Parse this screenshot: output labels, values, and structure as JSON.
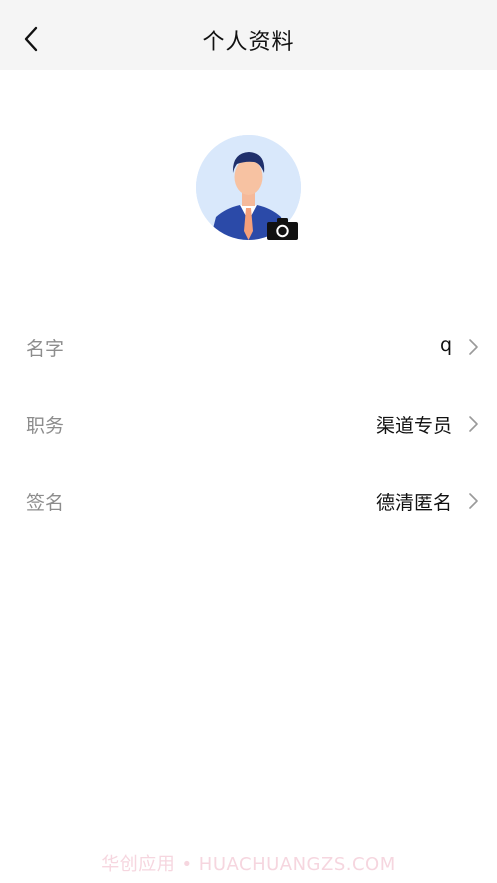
{
  "header": {
    "title": "个人资料"
  },
  "profile_rows": [
    {
      "label": "名字",
      "value": "q"
    },
    {
      "label": "职务",
      "value": "渠道专员"
    },
    {
      "label": "签名",
      "value": "德清匿名"
    }
  ],
  "watermark": "华创应用 • HUACHUANGZS.COM",
  "colors": {
    "nav_background": "#f5f5f5",
    "label_gray": "#8d8d8d",
    "avatar_background": "#d9e8fb",
    "tie_orange": "#f5a07a",
    "suit_blue": "#2b4aa8"
  }
}
